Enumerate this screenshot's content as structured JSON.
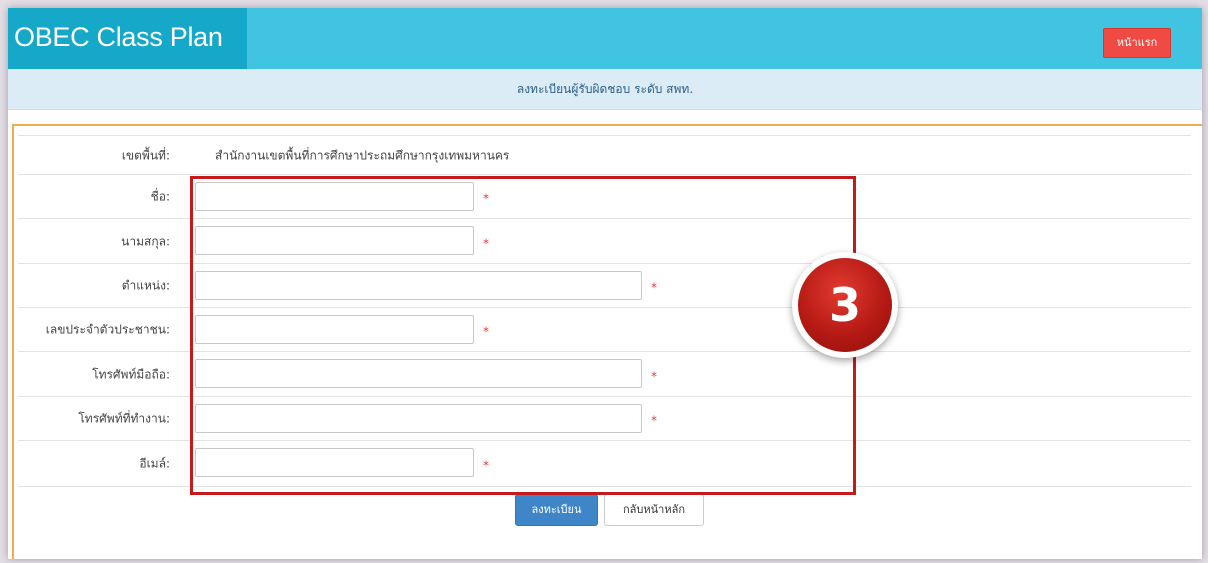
{
  "header": {
    "brand": "OBEC Class Plan",
    "home_label": "หน้าแรก",
    "bg_color": "#40c4e2",
    "brand_bg_color": "#16a8c8"
  },
  "page": {
    "subtitle": "ลงทะเบียนผู้รับผิดชอบ ระดับ สพท."
  },
  "form": {
    "area": {
      "label": "เขตพื้นที่:",
      "value": "สำนักงานเขตพื้นที่การศึกษาประถมศึกษากรุงเทพมหานคร"
    },
    "fields": [
      {
        "label": "ชื่อ:",
        "value": "",
        "required": "*"
      },
      {
        "label": "นามสกุล:",
        "value": "",
        "required": "*"
      },
      {
        "label": "ตำแหน่ง:",
        "value": "",
        "required": "*"
      },
      {
        "label": "เลขประจำตัวประชาชน:",
        "value": "",
        "required": "*"
      },
      {
        "label": "โทรศัพท์มือถือ:",
        "value": "",
        "required": "*"
      },
      {
        "label": "โทรศัพท์ที่ทำงาน:",
        "value": "",
        "required": "*"
      },
      {
        "label": "อีเมล์:",
        "value": "",
        "required": "*"
      }
    ],
    "submit_label": "ลงทะเบียน",
    "back_label": "กลับหน้าหลัก"
  },
  "annotation": {
    "step_number": "3",
    "highlight_color": "#c31a1a"
  }
}
